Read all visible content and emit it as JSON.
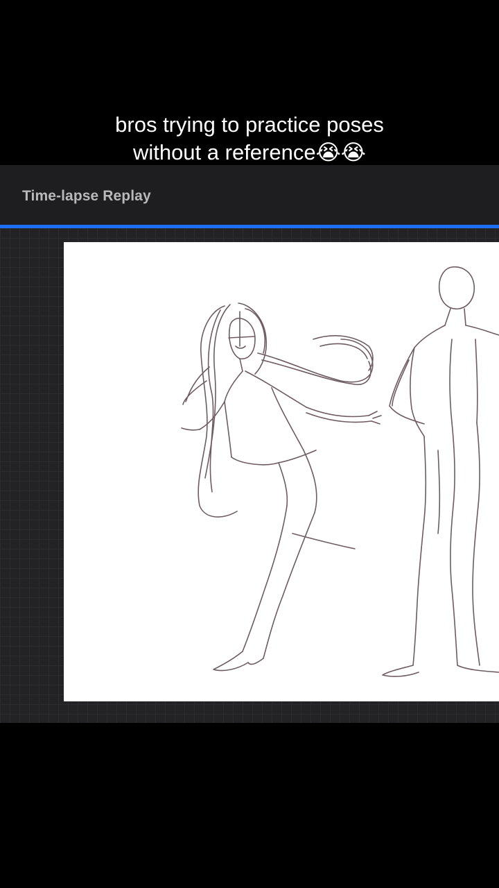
{
  "app": {
    "title": "Time-lapse Replay",
    "accent_color": "#1f6ff5",
    "replay_progress": 1.0
  },
  "caption": {
    "text": "bros trying to practice poses without a reference😭😭"
  },
  "canvas": {
    "content": "pencil-sketch-figure-poses",
    "stroke_color": "#5e4a50"
  }
}
